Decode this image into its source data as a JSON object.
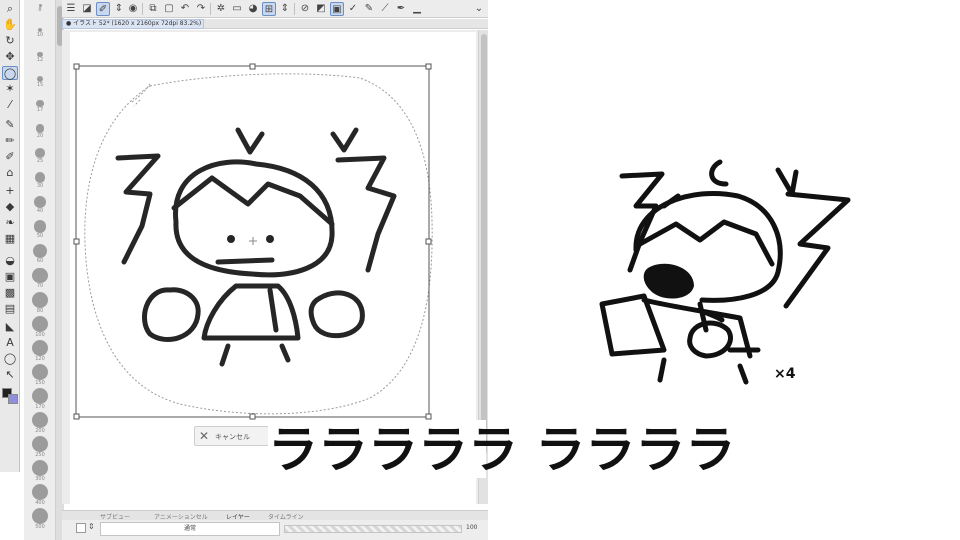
{
  "document": {
    "tab_title": "● イラスト 52* (1620 x 2160px 72dpi 83.2%)"
  },
  "brush_sizes": [
    "8",
    "10",
    "12",
    "15",
    "17",
    "20",
    "25",
    "30",
    "40",
    "50",
    "60",
    "70",
    "80",
    "100",
    "120",
    "150",
    "170",
    "200",
    "250",
    "300",
    "400",
    "500"
  ],
  "transform_bar": {
    "cancel_label": "キャンセル"
  },
  "bottom_panel": {
    "tabs": [
      "サブビュー",
      "アニメーションセル",
      "レイヤー",
      "タイムライン"
    ],
    "blend_mode": "通常",
    "opacity": "100"
  },
  "annotation": {
    "multiplier": "×4"
  },
  "caption": "ラララララ ララララ",
  "colors": {
    "toolbar_bg": "#ececec",
    "active_tool": "#c9d8ee",
    "stroke": "#222222",
    "selection_box": "#555555"
  },
  "icons": [
    "menu-icon",
    "lasso-icon",
    "move-icon",
    "pen-icon",
    "eraser-icon",
    "fill-icon",
    "gradient-icon",
    "text-icon",
    "cancel-icon"
  ]
}
